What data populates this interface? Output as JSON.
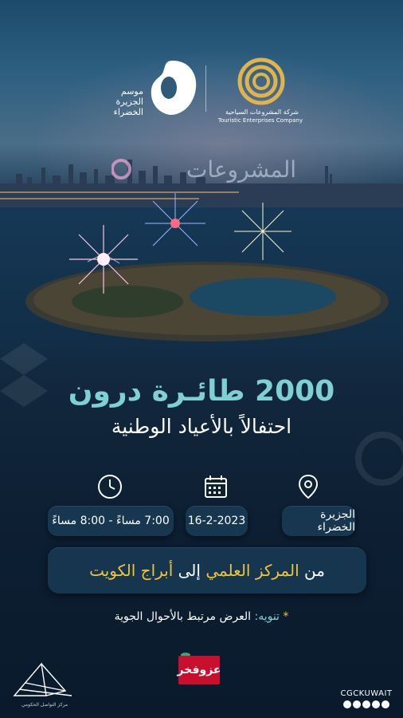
{
  "logos": {
    "green_island": "موسم الجزيرة الخضراء",
    "company_ar": "شركة المشروعات السياحية",
    "company_en": "Touristic Enterprises Company",
    "watermark": "المشروعات"
  },
  "headline": {
    "main": "2000 طائـرة درون",
    "sub": "احتفالاً بالأعياد الوطنية"
  },
  "info": {
    "location": {
      "icon": "location-pin-icon",
      "text": "الجزيرة الخضراء"
    },
    "date": {
      "icon": "calendar-icon",
      "text": "16-2-2023"
    },
    "time": {
      "icon": "clock-icon",
      "text": "7:00 مساءً - 8:00 مساءً"
    }
  },
  "route": {
    "prefix": "من ",
    "from": "المركز العلمي",
    "middle": " إلى ",
    "to": "أبراج الكويت"
  },
  "note": {
    "star": "*",
    "label": "تنويه:",
    "text": " العرض مرتبط بالأحوال الجوية"
  },
  "footer": {
    "badge": "عزوفخر",
    "handle": "CGCKUWAIT",
    "cgc_caption": "مركز التواصل الحكومي"
  },
  "colors": {
    "accent_teal": "#7fd0d2",
    "accent_gold": "#f0c53a",
    "badge_red": "#c8102e"
  }
}
